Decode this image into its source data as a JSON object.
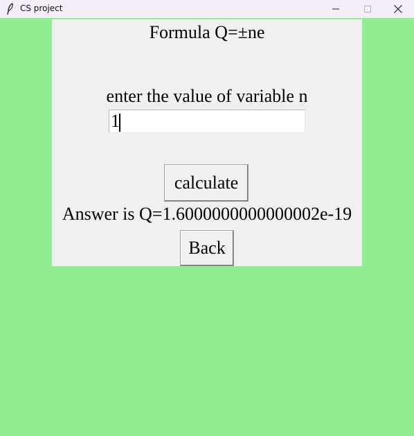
{
  "window": {
    "title": "CS project",
    "controls": {
      "minimize_icon": "minimize-icon",
      "maximize_icon": "maximize-icon",
      "close_icon": "close-icon"
    }
  },
  "colors": {
    "window_background": "#90ee90",
    "panel_background": "#f0f0f0",
    "titlebar_background": "#f3eef7"
  },
  "form": {
    "formula_label": "Formula Q=±ne",
    "prompt_label": "enter the value of variable n",
    "n_input_value": "1",
    "calculate_label": "calculate",
    "answer_text": "Answer is Q=1.6000000000000002e-19",
    "back_label": "Back"
  }
}
